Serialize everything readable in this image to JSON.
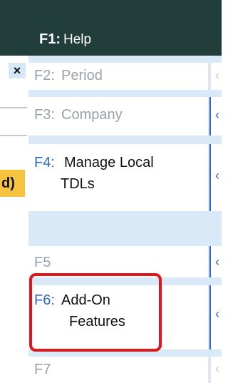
{
  "header": {
    "key": "F1:",
    "label": "Help"
  },
  "left": {
    "close_glyph": "×",
    "highlight_text": "d)"
  },
  "menu": [
    {
      "key": "F2:",
      "label": "Period",
      "enabled": false
    },
    {
      "key": "F3:",
      "label": "Company",
      "enabled": false
    },
    {
      "key": "F4:",
      "label_line1": "Manage Local",
      "label_line2": "TDLs",
      "enabled": true
    },
    {
      "key": "F5",
      "enabled": false
    },
    {
      "key": "F6:",
      "label_line1": "Add-On",
      "label_line2": "Features",
      "enabled": true,
      "highlighted": true
    },
    {
      "key": "F7",
      "enabled": false
    }
  ],
  "icons": {
    "chevron": "chevron-left-icon",
    "close": "close-icon"
  },
  "colors": {
    "header_bg": "#223e3a",
    "panel_bg": "#d9e9f8",
    "active_key": "#2f68c3",
    "disabled": "#9aa1a8",
    "highlight_outline": "#e0181c",
    "left_highlight": "#f6c440"
  }
}
